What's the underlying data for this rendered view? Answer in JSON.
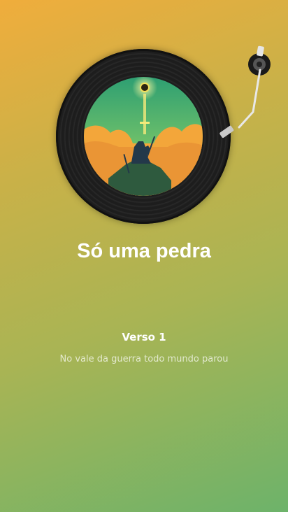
{
  "song": {
    "title": "Só uma pedra",
    "verse_label": "Verso 1",
    "current_line": "No vale da guerra todo mundo parou"
  },
  "artwork": {
    "icon": "album-art",
    "sky_color": "#4fae7a",
    "cloud_color": "#f3a63a"
  },
  "colors": {
    "background_start": "#f0ad3c",
    "background_end": "#6db36a",
    "record": "#1d1d1d"
  }
}
